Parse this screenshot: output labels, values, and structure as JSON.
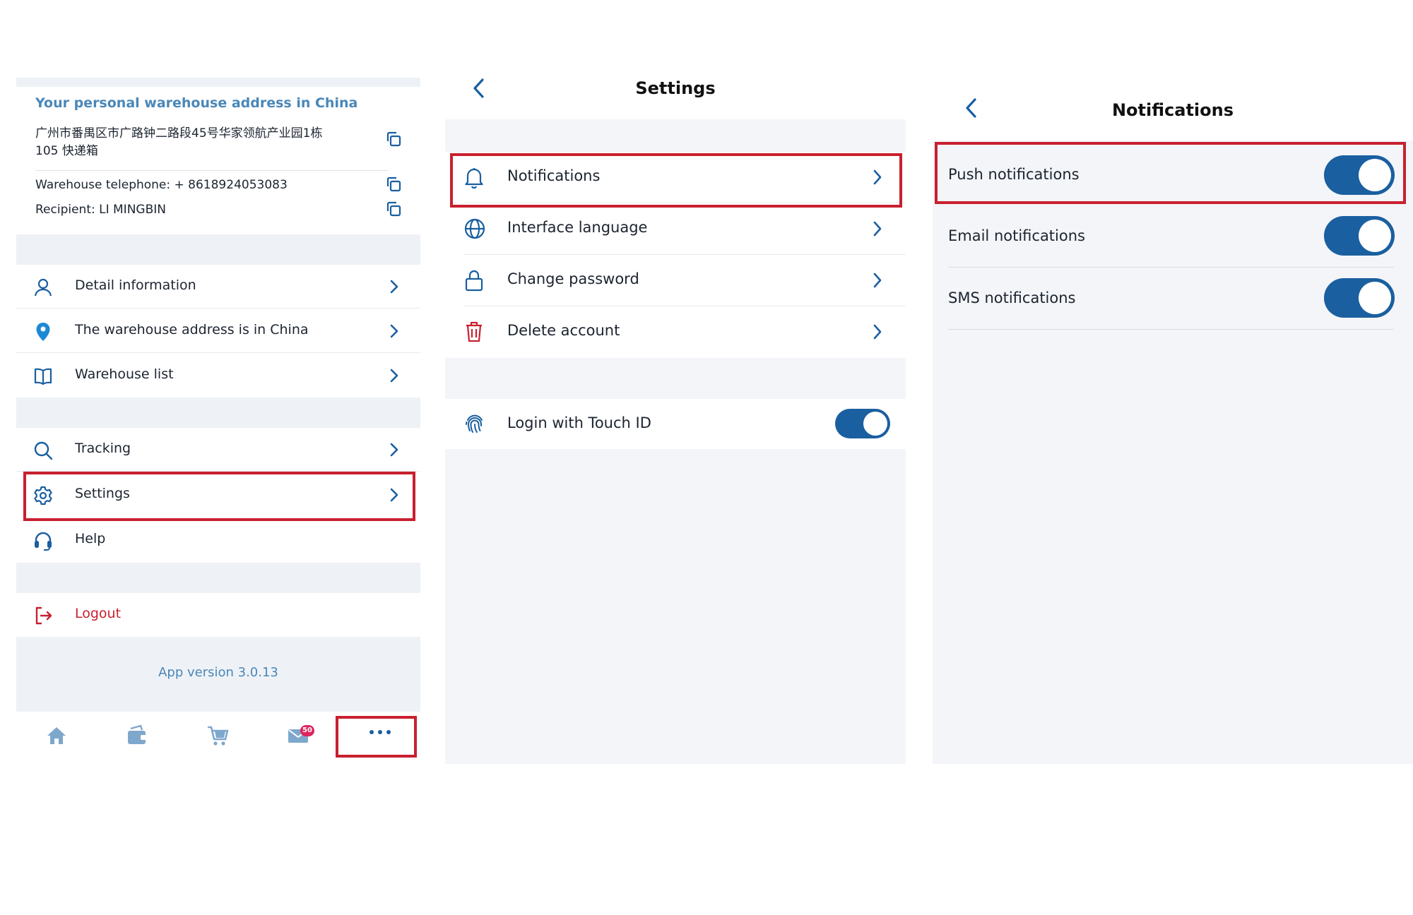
{
  "colors": {
    "accent": "#1a5fa0",
    "link": "#4a87b8",
    "danger": "#c8202f",
    "badge": "#e0245e"
  },
  "account": {
    "address_title": "Your personal warehouse address in China",
    "address_line1": "广州市番禺区市广路钟二路段45号华家领航产业园1栋",
    "address_line2": "105 快递箱",
    "phone": "Warehouse telephone: + 8618924053083",
    "recipient": "Recipient: LI MINGBIN",
    "menu": [
      {
        "label": "Detail information",
        "icon": "user-icon"
      },
      {
        "label": "The warehouse address is in China",
        "icon": "map-pin-icon"
      },
      {
        "label": "Warehouse list",
        "icon": "book-icon"
      },
      {
        "label": "Tracking",
        "icon": "search-icon"
      },
      {
        "label": "Settings",
        "icon": "gear-icon"
      },
      {
        "label": "Help",
        "icon": "headset-icon"
      }
    ],
    "logout": "Logout",
    "version": "App version 3.0.13",
    "tabbar": {
      "items": [
        "home-icon",
        "wallet-icon",
        "cart-icon",
        "mail-icon",
        "more-icon"
      ],
      "mail_badge": "50",
      "more_label": "···"
    }
  },
  "settings": {
    "title": "Settings",
    "items": [
      {
        "label": "Notifications",
        "icon": "bell-icon"
      },
      {
        "label": "Interface language",
        "icon": "globe-icon"
      },
      {
        "label": "Change password",
        "icon": "lock-icon"
      },
      {
        "label": "Delete account",
        "icon": "trash-icon"
      }
    ],
    "touch_id": {
      "label": "Login with Touch ID",
      "icon": "fingerprint-icon",
      "enabled": true
    }
  },
  "notifications": {
    "title": "Notifications",
    "items": [
      {
        "label": "Push notifications",
        "enabled": true
      },
      {
        "label": "Email notifications",
        "enabled": true
      },
      {
        "label": "SMS notifications",
        "enabled": true
      }
    ]
  }
}
